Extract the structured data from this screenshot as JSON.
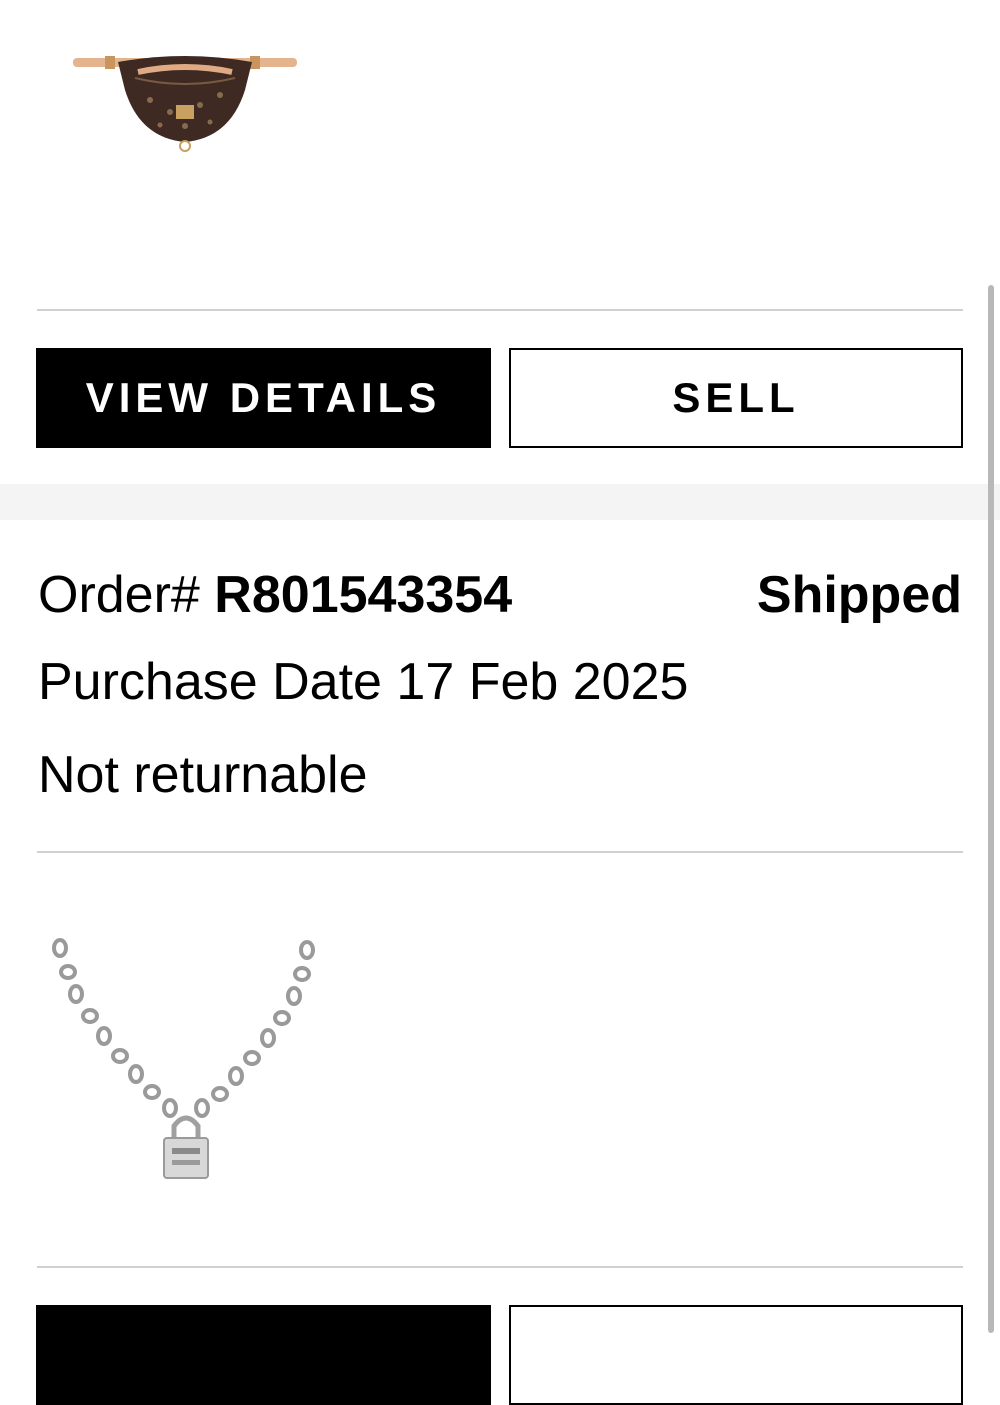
{
  "items": [
    {
      "image_icon": "belt-bag-image",
      "buttons": {
        "view_details": "VIEW DETAILS",
        "sell": "SELL"
      }
    },
    {
      "image_icon": "lock-necklace-image",
      "buttons": {
        "view_details": "",
        "sell": ""
      }
    }
  ],
  "order": {
    "label": "Order#",
    "number": "R801543354",
    "status": "Shipped",
    "purchase_date_label": "Purchase Date",
    "purchase_date": "17 Feb 2025",
    "returnable_text": "Not returnable"
  },
  "colors": {
    "primary_button_bg": "#000000",
    "divider": "#d0d0d0",
    "section_gap": "#f4f4f4"
  }
}
